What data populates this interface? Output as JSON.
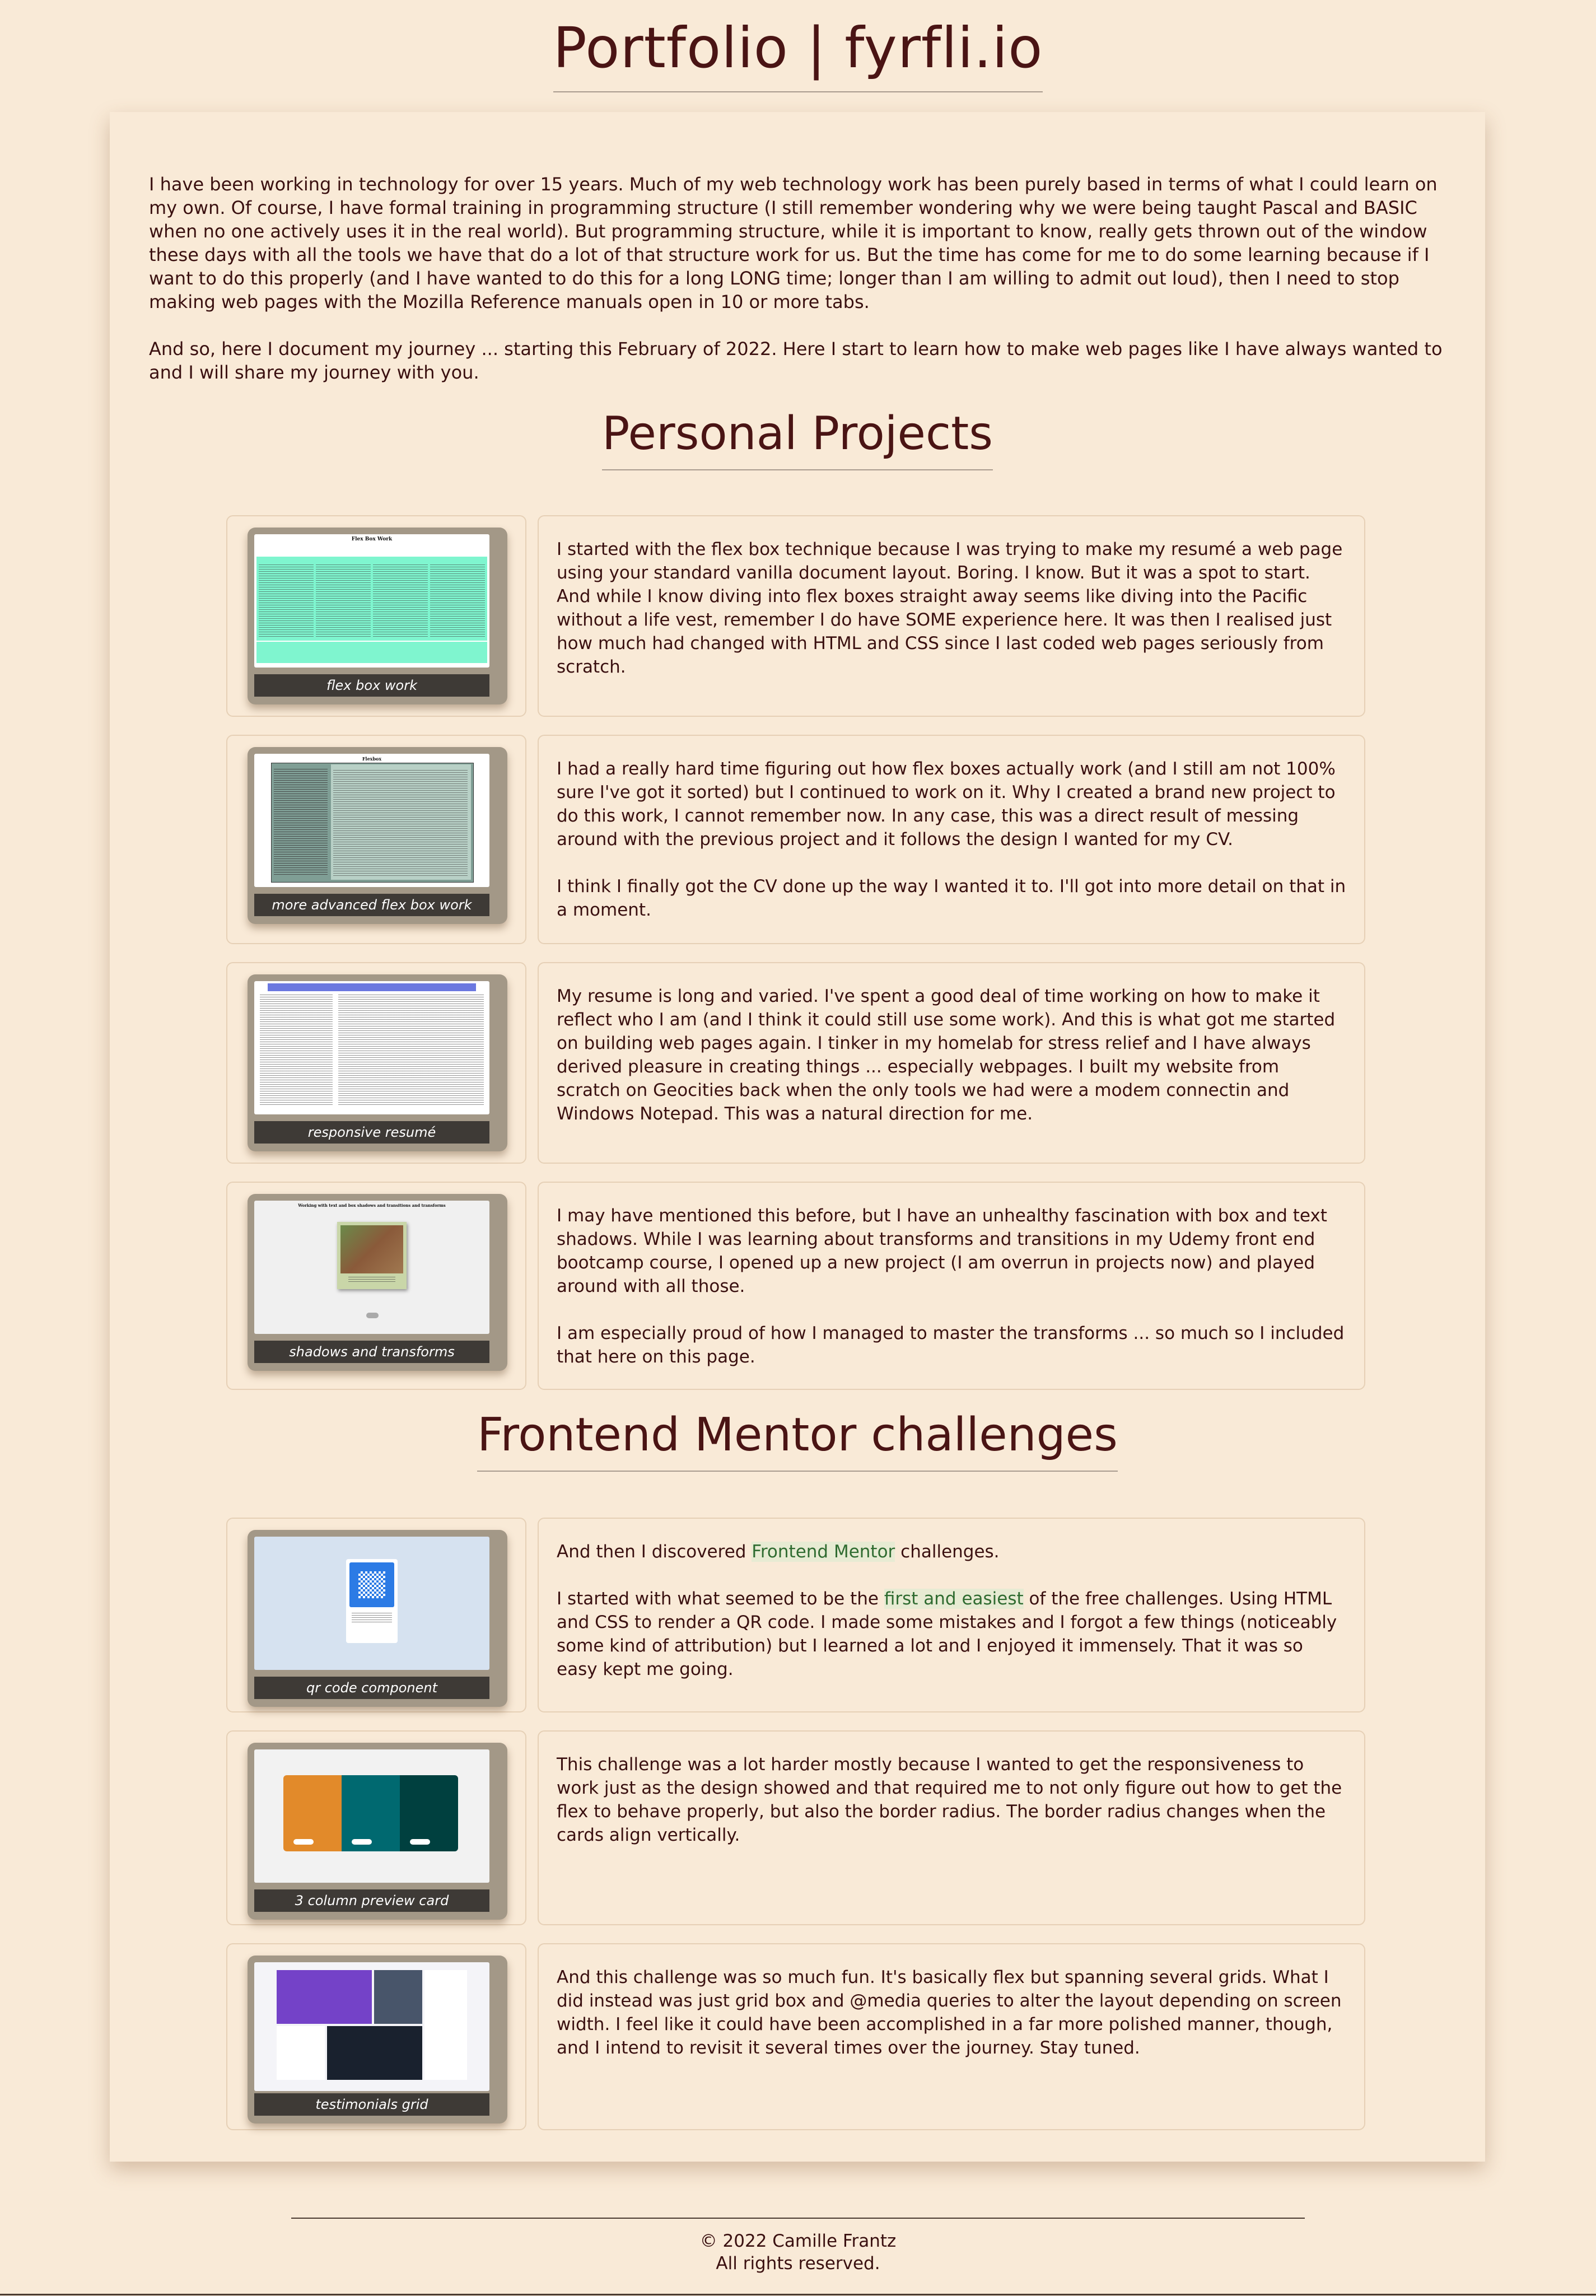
{
  "page": {
    "title": "Portfolio | fyrfli.io"
  },
  "intro": {
    "paragraph1": "I have been working in technology for over 15 years. Much of my web technology work has been purely based in terms of what I could learn on my own. Of course, I have formal training in programming structure (I still remember wondering why we were being taught Pascal and BASIC when no one actively uses it in the real world). But programming structure, while it is important to know, really gets thrown out of the window these days with all the tools we have that do a lot of that structure work for us. But the time has come for me to do some learning because if I want to do this properly (and I have wanted to do this for a long LONG time; longer than I am willing to admit out loud), then I need to stop making web pages with the Mozilla Reference manuals open in 10 or more tabs.",
    "paragraph2": "And so, here I document my journey ... starting this February of 2022. Here I start to learn how to make web pages like I have always wanted to and I will share my journey with you."
  },
  "personal_projects": {
    "heading": "Personal Projects",
    "items": [
      {
        "caption": "flex box work",
        "thumb_title": "Flex Box Work",
        "paragraphs": [
          "I started with the flex box technique because I was trying to make my resumé a web page using your standard vanilla document layout. Boring. I know. But it was a spot to start. And while I know diving into flex boxes straight away seems like diving into the Pacific without a life vest, remember I do have SOME experience here. It was then I realised just how much had changed with HTML and CSS since I last coded web pages seriously from scratch."
        ]
      },
      {
        "caption": "more advanced flex box work",
        "thumb_title": "Flexbox",
        "paragraphs": [
          "I had a really hard time figuring out how flex boxes actually work (and I still am not 100% sure I've got it sorted) but I continued to work on it. Why I created a brand new project to do this work, I cannot remember now. In any case, this was a direct result of messing around with the previous project and it follows the design I wanted for my CV.",
          "I think I finally got the CV done up the way I wanted it to. I'll got into more detail on that in a moment."
        ]
      },
      {
        "caption": "responsive resumé",
        "paragraphs": [
          "My resume is long and varied. I've spent a good deal of time working on how to make it reflect who I am (and I think it could still use some work). And this is what got me started on building web pages again. I tinker in my homelab for stress relief and I have always derived pleasure in creating things ... especially webpages. I built my website from scratch on Geocities back when the only tools we had were a modem connectin and Windows Notepad. This was a natural direction for me."
        ]
      },
      {
        "caption": "shadows and transforms",
        "thumb_title": "Working with text and box shadows and transitions and transforms",
        "paragraphs": [
          "I may have mentioned this before, but I have an unhealthy fascination with box and text shadows. While I was learning about transforms and transitions in my Udemy front end bootcamp course, I opened up a new project (I am overrun in projects now) and played around with all those.",
          "I am especially proud of how I managed to master the transforms ... so much so I included that here on this page."
        ]
      }
    ]
  },
  "frontend_mentor": {
    "heading": "Frontend Mentor challenges",
    "items": [
      {
        "caption": "qr code component",
        "p1_pre": "And then I discovered ",
        "p1_link": "Frontend Mentor",
        "p1_post": " challenges.",
        "p2_pre": "I started with what seemed to be the ",
        "p2_link": "first and easiest",
        "p2_post": " of the free challenges. Using HTML and CSS to render a QR code. I made some mistakes and I forgot a few things (noticeably some kind of attribution) but I learned a lot and I enjoyed it immensely. That it was so easy kept me going."
      },
      {
        "caption": "3 column preview card",
        "paragraphs": [
          "This challenge was a lot harder mostly because I wanted to get the responsiveness to work just as the design showed and that required me to not only figure out how to get the flex to behave properly, but also the border radius. The border radius changes when the cards align vertically."
        ]
      },
      {
        "caption": "testimonials grid",
        "paragraphs": [
          "And this challenge was so much fun. It's basically flex but spanning several grids. What I did instead was just grid box and @media queries to alter the layout depending on screen width. I feel like it could have been accomplished in a far more polished manner, though, and I intend to revisit it several times over the journey. Stay tuned."
        ]
      }
    ]
  },
  "footer": {
    "copyright": "© 2022 Camille Frantz",
    "rights": "All rights reserved."
  },
  "colors": {
    "background": "#f9ead7",
    "heading": "#4a1414",
    "link_highlight": "#e7ebd3",
    "link_text": "#2f6b30"
  }
}
